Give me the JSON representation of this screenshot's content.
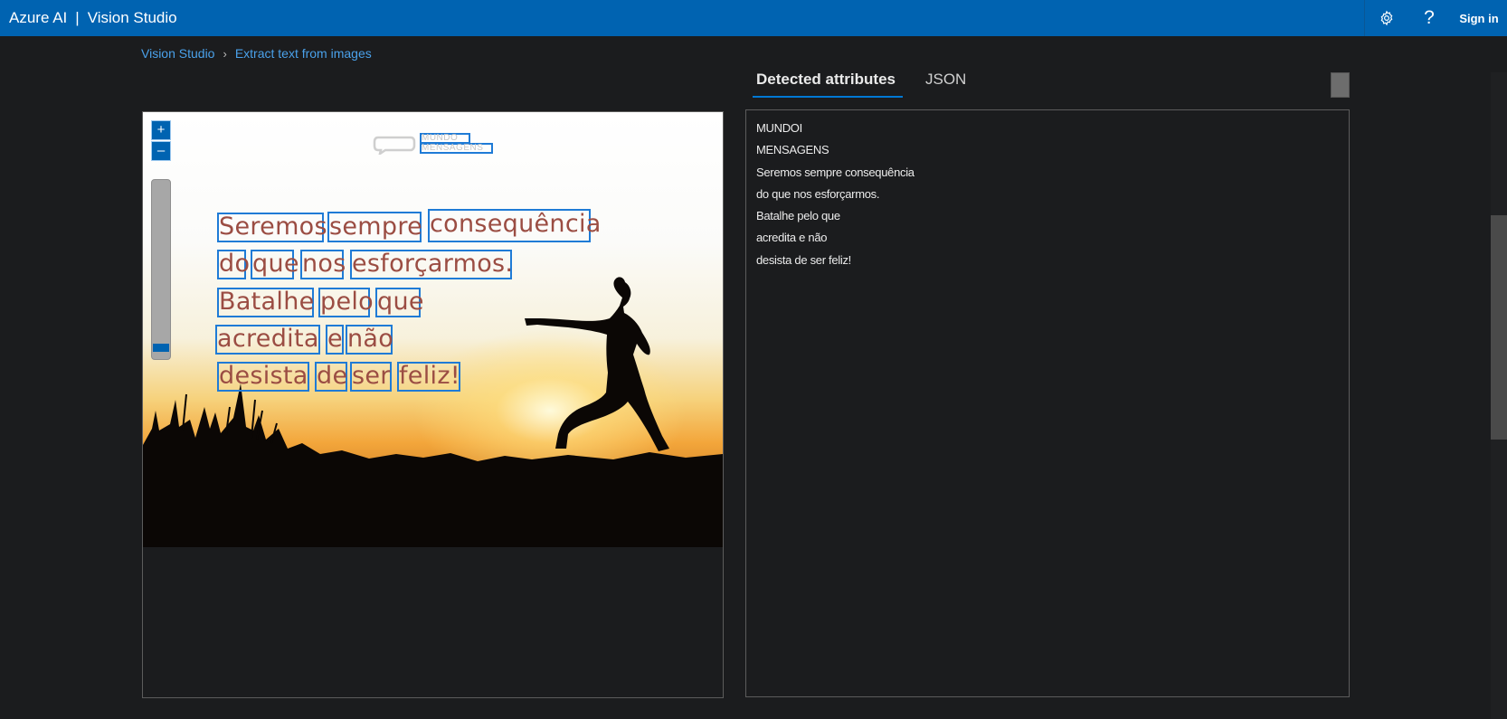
{
  "header": {
    "brand_product": "Azure AI",
    "brand_separator": "|",
    "brand_app": "Vision Studio",
    "settings_icon": "gear-icon",
    "help_label": "?",
    "sign_in_label": "Sign in"
  },
  "breadcrumb": {
    "items": [
      "Vision Studio",
      "Extract text from images"
    ],
    "separator": "›"
  },
  "image_viewer": {
    "zoom_in_label": "+",
    "zoom_out_label": "–",
    "logo_words": [
      "MUNDO",
      "MENSAGENS"
    ],
    "ocr_words": [
      "Seremos",
      "sempre",
      "consequência",
      "do",
      "que",
      "nos",
      "esforçarmos.",
      "Batalhe",
      "pelo",
      "que",
      "acredita",
      "e",
      "não",
      "desista",
      "de",
      "ser",
      "feliz!"
    ]
  },
  "results": {
    "tabs": [
      {
        "label": "Detected attributes",
        "active": true
      },
      {
        "label": "JSON",
        "active": false
      }
    ],
    "lines": [
      "MUNDOI",
      "MENSAGENS",
      "Seremos sempre consequência",
      "do que nos esforçarmos.",
      "Batalhe pelo que",
      "acredita e não",
      "desista de ser feliz!"
    ]
  },
  "colors": {
    "header_bg": "#0063b1",
    "page_bg": "#1b1c1e",
    "link": "#4aa1ea",
    "ocr_box": "#1f7bd6",
    "ocr_text": "#9b4d43"
  }
}
